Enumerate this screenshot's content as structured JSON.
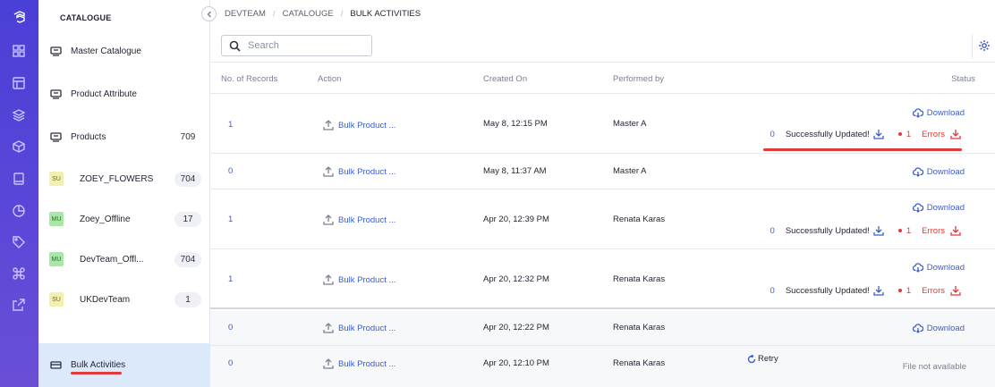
{
  "app": {
    "accent_color": "#3b5ccc",
    "rail_color": "#4a3fd6",
    "error_color": "#e03a3a"
  },
  "rail_icons": [
    "logo-icon",
    "grid-icon",
    "layout-icon",
    "layers-icon",
    "box-icon",
    "book-icon",
    "pie-chart-icon",
    "tag-icon",
    "command-icon",
    "export-icon"
  ],
  "sidebar": {
    "title": "CATALOGUE",
    "items": [
      {
        "label": "Master Catalogue",
        "icon": "catalogue-icon"
      },
      {
        "label": "Product Attribute",
        "icon": "catalogue-icon"
      },
      {
        "label": "Products",
        "icon": "catalogue-icon",
        "badge": "709"
      },
      {
        "label": "ZOEY_FLOWERS",
        "tag": "SU",
        "badge": "704"
      },
      {
        "label": "Zoey_Offline",
        "tag": "MU",
        "badge": "17"
      },
      {
        "label": "DevTeam_Offl...",
        "tag": "MU",
        "badge": "704"
      },
      {
        "label": "UKDevTeam",
        "tag": "SU",
        "badge": "1"
      }
    ],
    "active": {
      "label": "Bulk Activities",
      "icon": "bulk-icon"
    }
  },
  "breadcrumb": [
    "DEVTEAM",
    "CATALOUGE",
    "BULK ACTIVITIES"
  ],
  "search": {
    "placeholder": "Search"
  },
  "table": {
    "headers": {
      "records": "No. of Records",
      "action": "Action",
      "created": "Created On",
      "performed": "Performed by",
      "status": "Status"
    },
    "rows": [
      {
        "records": "1",
        "action": "Bulk Product ...",
        "created": "May 8, 12:15 PM",
        "performed": "Master A",
        "download": "Download",
        "success_count": "0",
        "success_label": "Successfully Updated!",
        "error_count": "1",
        "error_label": "Errors"
      },
      {
        "records": "0",
        "action": "Bulk Product ...",
        "created": "May 8, 11:37 AM",
        "performed": "Master A",
        "download": "Download"
      },
      {
        "records": "1",
        "action": "Bulk Product ...",
        "created": "Apr 20, 12:39 PM",
        "performed": "Renata Karas",
        "download": "Download",
        "success_count": "0",
        "success_label": "Successfully Updated!",
        "error_count": "1",
        "error_label": "Errors"
      },
      {
        "records": "1",
        "action": "Bulk Product ...",
        "created": "Apr 20, 12:32 PM",
        "performed": "Renata Karas",
        "download": "Download",
        "success_count": "0",
        "success_label": "Successfully Updated!",
        "error_count": "1",
        "error_label": "Errors"
      },
      {
        "records": "0",
        "action": "Bulk Product ...",
        "created": "Apr 20, 12:22 PM",
        "performed": "Renata Karas",
        "download": "Download"
      },
      {
        "records": "0",
        "action": "Bulk Product ...",
        "created": "Apr 20, 12:10 PM",
        "performed": "Renata Karas",
        "retry": "Retry",
        "file_status": "File not available"
      }
    ]
  }
}
